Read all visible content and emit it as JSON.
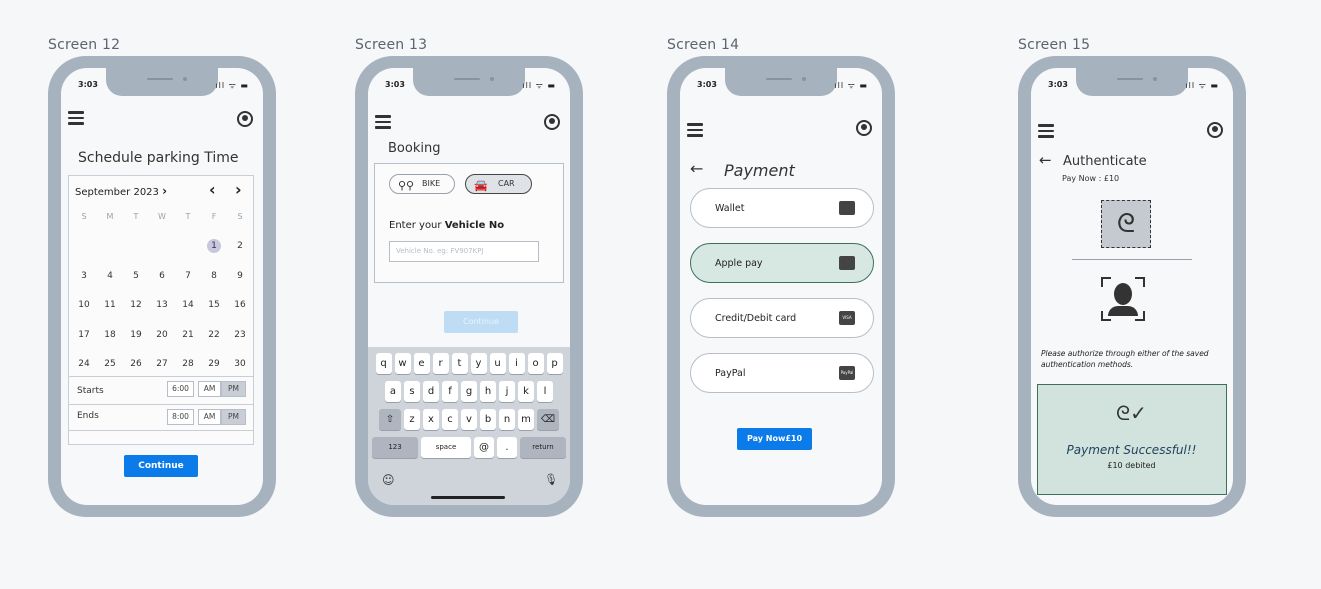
{
  "labels": {
    "s12": "Screen 12",
    "s13": "Screen 13",
    "s14": "Screen 14",
    "s15": "Screen 15"
  },
  "status_time": "3:03",
  "status_icons": "ıll ᯤ ▬",
  "s12": {
    "title": "Schedule parking Time",
    "month": "September 2023",
    "next_month_icon": "chevron-right-icon",
    "dow": [
      "S",
      "M",
      "T",
      "W",
      "T",
      "F",
      "S"
    ],
    "weeks": [
      [
        "",
        "",
        "",
        "",
        "",
        "1",
        "2"
      ],
      [
        "3",
        "4",
        "5",
        "6",
        "7",
        "8",
        "9"
      ],
      [
        "10",
        "11",
        "12",
        "13",
        "14",
        "15",
        "16"
      ],
      [
        "17",
        "18",
        "19",
        "20",
        "21",
        "22",
        "23"
      ],
      [
        "24",
        "25",
        "26",
        "27",
        "28",
        "29",
        "30"
      ]
    ],
    "selected_day": "1",
    "starts_label": "Starts",
    "starts_time": "6:00",
    "ends_label": "Ends",
    "ends_time": "8:00",
    "am": "AM",
    "pm": "PM",
    "continue": "Continue"
  },
  "s13": {
    "title": "Booking",
    "bike": "BIKE",
    "car": "CAR",
    "vehicle_prompt": "Enter your ",
    "vehicle_prompt_bold": "Vehicle No",
    "vehicle_placeholder": "Vehicle No. eg: FV907KPJ",
    "continue": "Continue",
    "kb_row1": [
      "q",
      "w",
      "e",
      "r",
      "t",
      "y",
      "u",
      "i",
      "o",
      "p"
    ],
    "kb_row2": [
      "a",
      "s",
      "d",
      "f",
      "g",
      "h",
      "j",
      "k",
      "l"
    ],
    "kb_row3": [
      "z",
      "x",
      "c",
      "v",
      "b",
      "n",
      "m"
    ],
    "kb_123": "123",
    "kb_space": "space",
    "kb_at": "@",
    "kb_dot": ".",
    "kb_return": "return"
  },
  "s14": {
    "title": "Payment",
    "options": [
      "Wallet",
      "Apple pay",
      "Credit/Debit card",
      "PayPal"
    ],
    "option_marks": [
      "",
      "",
      "VISA",
      "PayPal"
    ],
    "selected_index": 1,
    "pay_now": "Pay Now£10"
  },
  "s15": {
    "title": "Authenticate",
    "pay_now": "Pay Now : £10",
    "note": "Please authorize through either of the saved authentication methods.",
    "success": "Payment Successful!!",
    "debited": "£10 debited"
  }
}
